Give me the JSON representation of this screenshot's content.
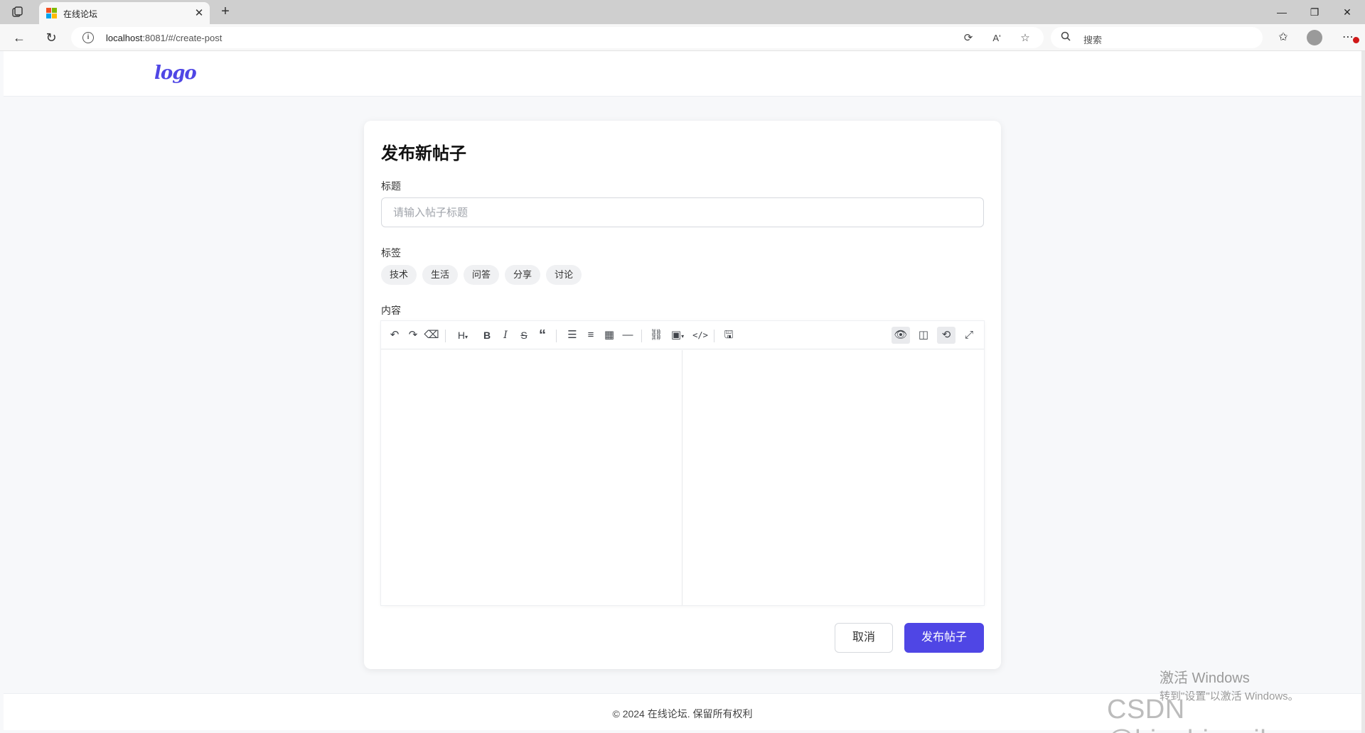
{
  "browser": {
    "tab_title": "在线论坛",
    "url_host": "localhost",
    "url_path": ":8081/#/create-post",
    "search_placeholder": "搜索",
    "read_aloud_label": "Aʹ"
  },
  "header": {
    "logo_text": "logo"
  },
  "form": {
    "page_title": "发布新帖子",
    "title_label": "标题",
    "title_placeholder": "请输入帖子标题",
    "title_value": "",
    "tags_label": "标签",
    "tags": [
      "技术",
      "生活",
      "问答",
      "分享",
      "讨论"
    ],
    "content_label": "内容",
    "toolbar_icons": [
      "undo",
      "redo",
      "clear",
      "heading",
      "bold",
      "italic",
      "strikethrough",
      "quote",
      "unordered-list",
      "ordered-list",
      "table",
      "horizontal-rule",
      "link",
      "image",
      "code",
      "save",
      "preview",
      "catalog",
      "sync-scroll",
      "fullscreen"
    ],
    "cancel_label": "取消",
    "submit_label": "发布帖子"
  },
  "footer": {
    "text": "© 2024 在线论坛. 保留所有权利"
  },
  "os_overlay": {
    "activate_title": "激活 Windows",
    "activate_hint": "转到\"设置\"以激活 Windows。",
    "watermark": "CSDN @bingbingyihao"
  },
  "colors": {
    "accent": "#4f46e5",
    "page_bg": "#f7f8fa"
  }
}
